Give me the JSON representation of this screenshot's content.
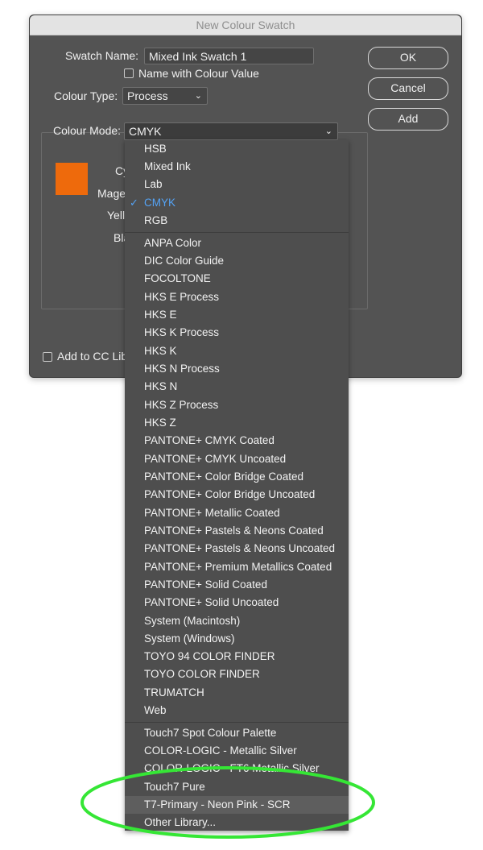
{
  "window": {
    "title": "New Colour Swatch"
  },
  "fields": {
    "swatch_name_label": "Swatch Name:",
    "swatch_name_value": "Mixed Ink Swatch 1",
    "name_with_value_label": "Name with Colour Value",
    "colour_type_label": "Colour Type:",
    "colour_type_value": "Process",
    "colour_mode_label": "Colour Mode:",
    "colour_mode_value": "CMYK"
  },
  "buttons": {
    "ok": "OK",
    "cancel": "Cancel",
    "add": "Add"
  },
  "sliders": {
    "cyan": "Cy",
    "magenta": "Mage",
    "yellow": "Yell",
    "black": "Bla"
  },
  "cc_library_label": "Add to CC Lib",
  "swatch_color": "#ee6a0c",
  "menu": {
    "group1": [
      "HSB",
      "Mixed Ink",
      "Lab",
      "CMYK",
      "RGB"
    ],
    "selected": "CMYK",
    "group2": [
      "ANPA Color",
      "DIC Color Guide",
      "FOCOLTONE",
      "HKS E Process",
      "HKS E",
      "HKS K Process",
      "HKS K",
      "HKS N Process",
      "HKS N",
      "HKS Z Process",
      "HKS Z",
      "PANTONE+ CMYK Coated",
      "PANTONE+ CMYK Uncoated",
      "PANTONE+ Color Bridge Coated",
      "PANTONE+ Color Bridge Uncoated",
      "PANTONE+ Metallic Coated",
      "PANTONE+ Pastels & Neons Coated",
      "PANTONE+ Pastels & Neons Uncoated",
      "PANTONE+ Premium Metallics Coated",
      "PANTONE+ Solid Coated",
      "PANTONE+ Solid Uncoated",
      "System (Macintosh)",
      "System (Windows)",
      "TOYO 94 COLOR FINDER",
      "TOYO COLOR FINDER",
      "TRUMATCH",
      "Web"
    ],
    "group3": [
      "Touch7 Spot Colour Palette",
      "COLOR-LOGIC - Metallic Silver",
      "COLOR-LOGIC - FT6 Metallic Silver",
      "Touch7 Pure",
      "T7-Primary - Neon Pink - SCR",
      "Other Library..."
    ],
    "highlighted": "T7-Primary - Neon Pink - SCR"
  },
  "annotation_color": "#35e635"
}
